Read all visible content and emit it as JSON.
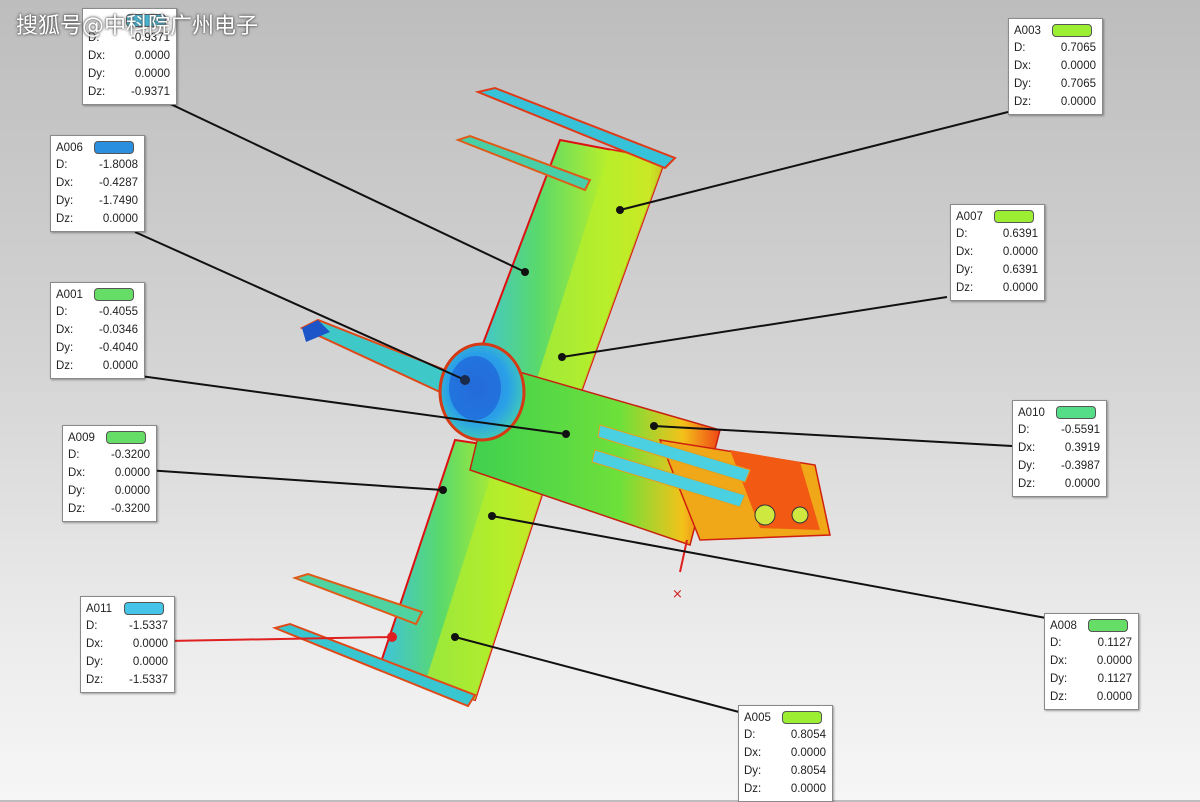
{
  "watermark": "搜狐号@中科院广州电子",
  "colors": {
    "green": "#66dd66",
    "cyan": "#44c4e8",
    "blue": "#2b8fe0",
    "lime": "#9cee33",
    "red": "#e02020"
  },
  "callouts": [
    {
      "id": "A003",
      "swatch": "#9cee33",
      "rows": [
        {
          "k": "D:",
          "v": "0.7065"
        },
        {
          "k": "Dx:",
          "v": "0.0000"
        },
        {
          "k": "Dy:",
          "v": "0.7065"
        },
        {
          "k": "Dz:",
          "v": "0.0000"
        }
      ]
    },
    {
      "id": "A006",
      "swatch": "#2b8fe0",
      "rows": [
        {
          "k": "D:",
          "v": "-1.8008"
        },
        {
          "k": "Dx:",
          "v": "-0.4287"
        },
        {
          "k": "Dy:",
          "v": "-1.7490"
        },
        {
          "k": "Dz:",
          "v": "0.0000"
        }
      ]
    },
    {
      "id": "A007",
      "swatch": "#9cee33",
      "rows": [
        {
          "k": "D:",
          "v": "0.6391"
        },
        {
          "k": "Dx:",
          "v": "0.0000"
        },
        {
          "k": "Dy:",
          "v": "0.6391"
        },
        {
          "k": "Dz:",
          "v": "0.0000"
        }
      ]
    },
    {
      "id": "A001",
      "swatch": "#66dd66",
      "rows": [
        {
          "k": "D:",
          "v": "-0.4055"
        },
        {
          "k": "Dx:",
          "v": "-0.0346"
        },
        {
          "k": "Dy:",
          "v": "-0.4040"
        },
        {
          "k": "Dz:",
          "v": "0.0000"
        }
      ]
    },
    {
      "id": "A010",
      "swatch": "#55dd88",
      "rows": [
        {
          "k": "D:",
          "v": "-0.5591"
        },
        {
          "k": "Dx:",
          "v": "0.3919"
        },
        {
          "k": "Dy:",
          "v": "-0.3987"
        },
        {
          "k": "Dz:",
          "v": "0.0000"
        }
      ]
    },
    {
      "id": "A009",
      "swatch": "#66dd66",
      "rows": [
        {
          "k": "D:",
          "v": "-0.3200"
        },
        {
          "k": "Dx:",
          "v": "0.0000"
        },
        {
          "k": "Dy:",
          "v": "0.0000"
        },
        {
          "k": "Dz:",
          "v": "-0.3200"
        }
      ]
    },
    {
      "id": "A011",
      "swatch": "#44c4e8",
      "rows": [
        {
          "k": "D:",
          "v": "-1.5337"
        },
        {
          "k": "Dx:",
          "v": "0.0000"
        },
        {
          "k": "Dy:",
          "v": "0.0000"
        },
        {
          "k": "Dz:",
          "v": "-1.5337"
        }
      ]
    },
    {
      "id": "A008",
      "swatch": "#66dd66",
      "rows": [
        {
          "k": "D:",
          "v": "0.1127"
        },
        {
          "k": "Dx:",
          "v": "0.0000"
        },
        {
          "k": "Dy:",
          "v": "0.1127"
        },
        {
          "k": "Dz:",
          "v": "0.0000"
        }
      ]
    },
    {
      "id": "A005",
      "swatch": "#9cee33",
      "rows": [
        {
          "k": "D:",
          "v": "0.8054"
        },
        {
          "k": "Dx:",
          "v": "0.0000"
        },
        {
          "k": "Dy:",
          "v": "0.8054"
        },
        {
          "k": "Dz:",
          "v": "0.0000"
        }
      ]
    }
  ],
  "top_left_callout": {
    "rows": [
      {
        "k": "D:",
        "v": "-0.9371"
      },
      {
        "k": "Dx:",
        "v": "0.0000"
      },
      {
        "k": "Dy:",
        "v": "0.0000"
      },
      {
        "k": "Dz:",
        "v": "-0.9371"
      }
    ]
  }
}
